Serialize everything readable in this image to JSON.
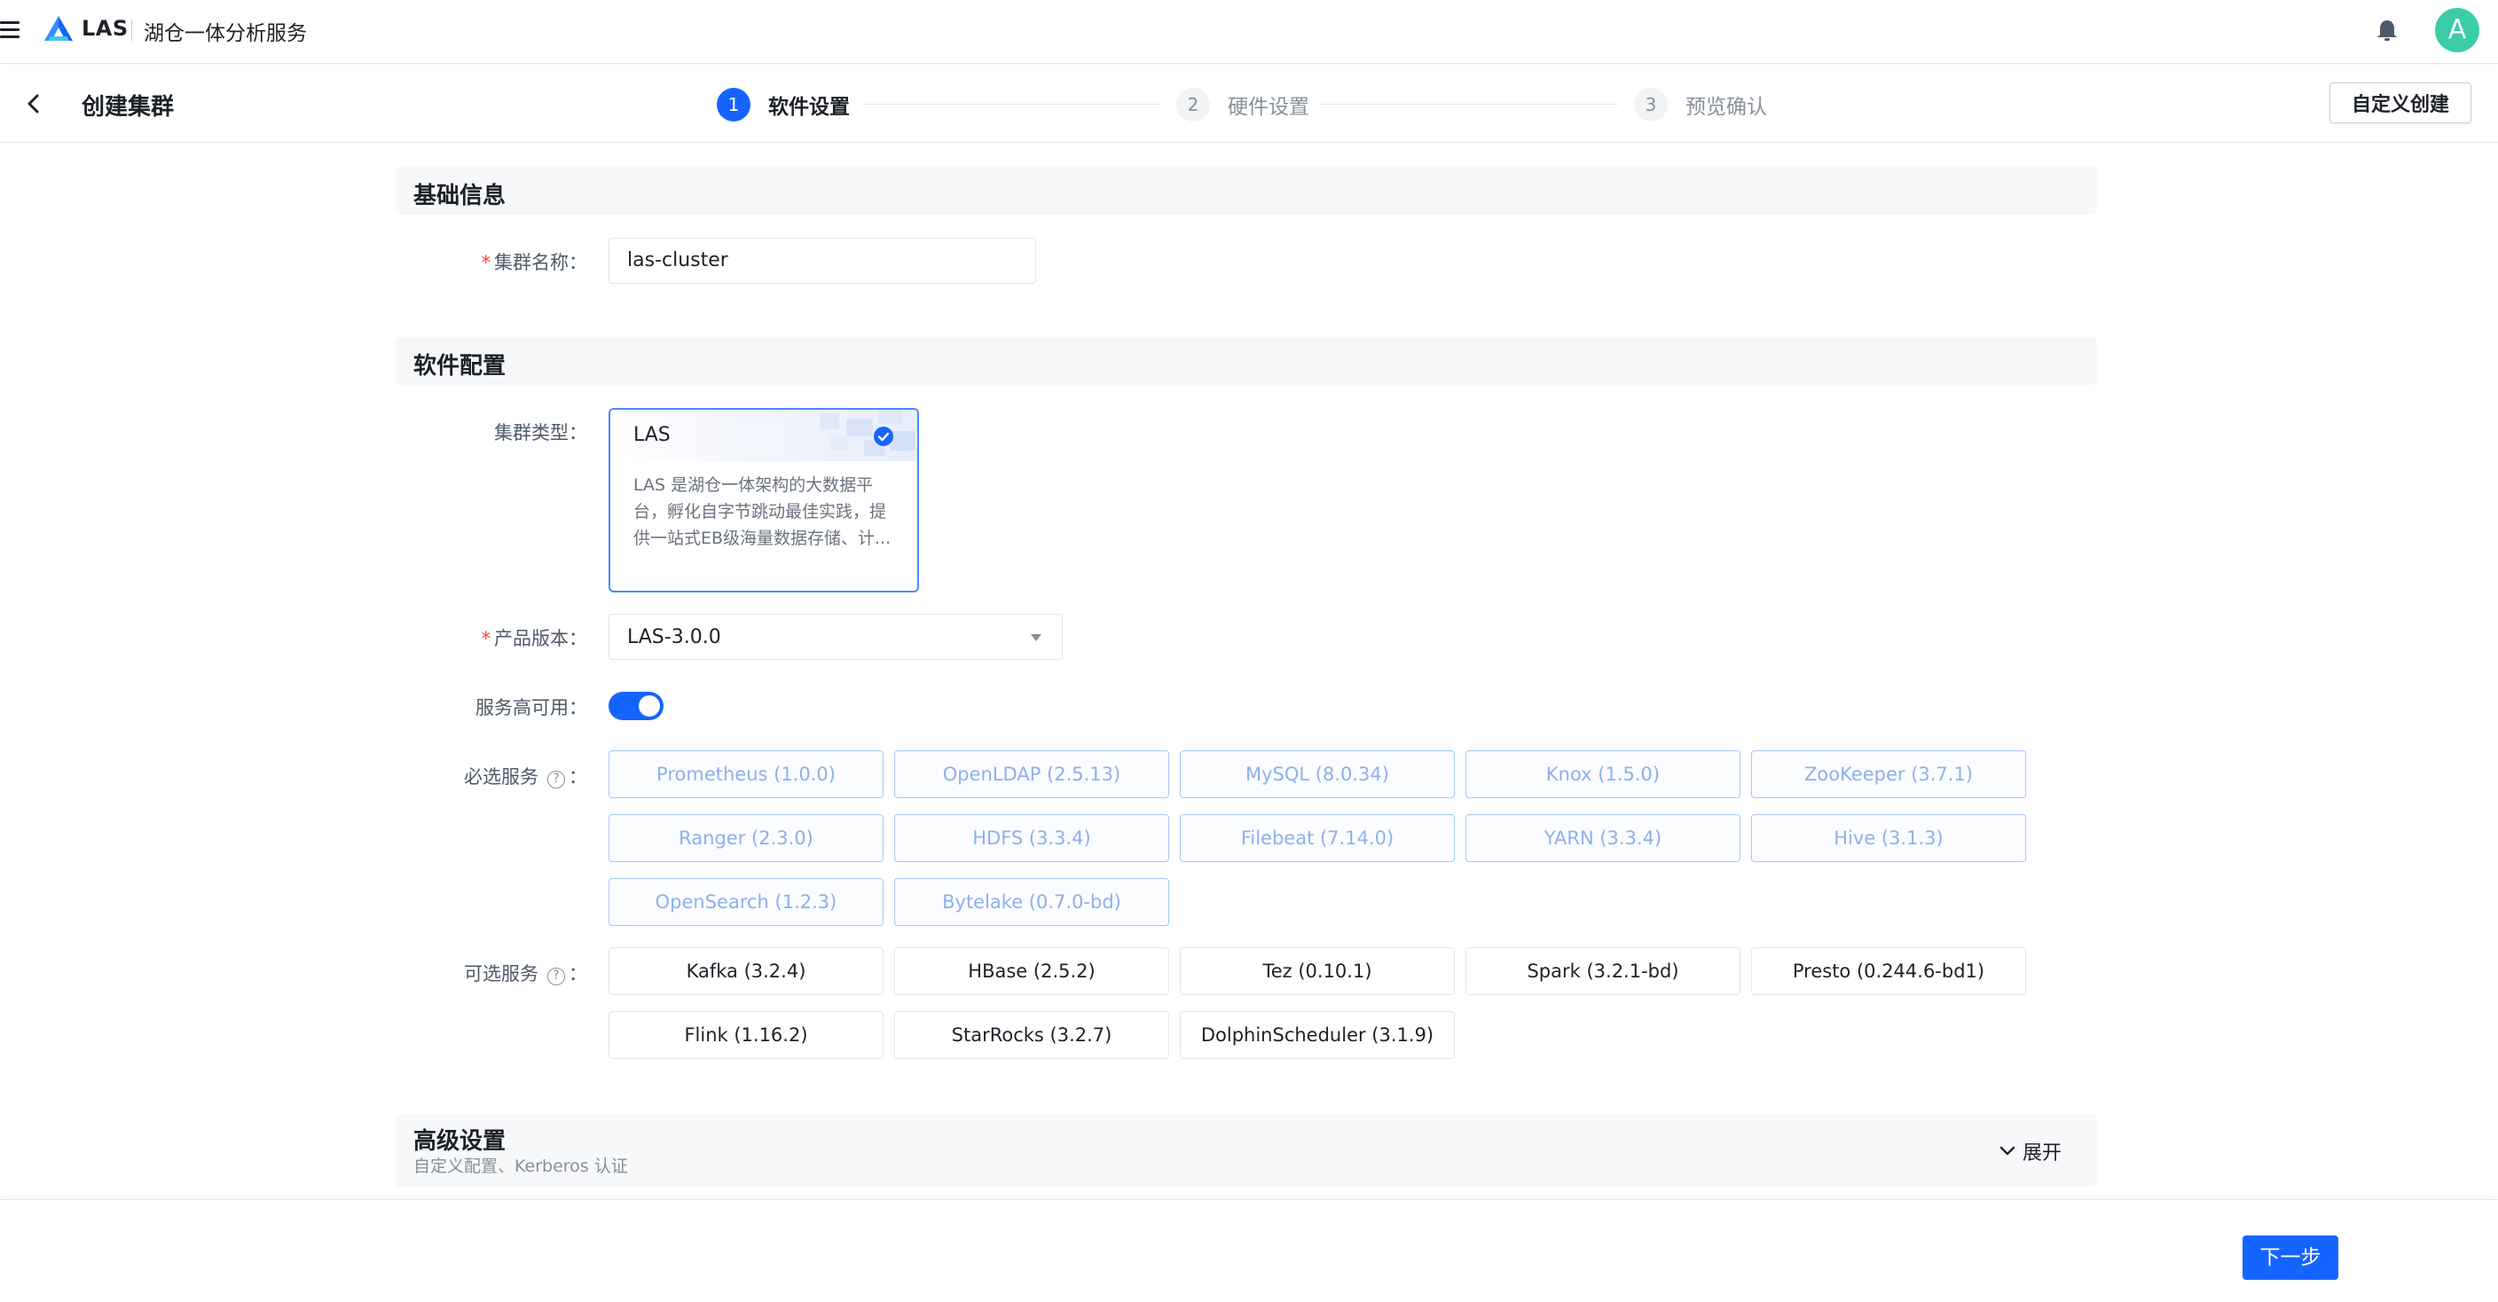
{
  "topbar": {
    "logo_text": "LAS",
    "product_name": "湖仓一体分析服务",
    "avatar_letter": "A",
    "accent": "#1664ff",
    "avatar_color": "#3dcca8"
  },
  "header": {
    "title": "创建集群",
    "custom_create": "自定义创建",
    "steps": [
      {
        "num": "1",
        "label": "软件设置",
        "active": true
      },
      {
        "num": "2",
        "label": "硬件设置",
        "active": false
      },
      {
        "num": "3",
        "label": "预览确认",
        "active": false
      }
    ]
  },
  "basic": {
    "title": "基础信息",
    "cluster_name_label": "集群名称",
    "cluster_name_value": "las-cluster"
  },
  "software": {
    "title": "软件配置",
    "cluster_type_label": "集群类型",
    "cluster_type": {
      "name": "LAS",
      "selected": true,
      "desc_lines": [
        "LAS 是湖仓一体架构的大数据平",
        "台，孵化自字节跳动最佳实践，提",
        "供一站式EB级海量数据存储、计..."
      ]
    },
    "version_label": "产品版本",
    "version_value": "LAS-3.0.0",
    "ha_label": "服务高可用",
    "ha_enabled": true,
    "required_label": "必选服务",
    "required_services": [
      "Prometheus (1.0.0)",
      "OpenLDAP (2.5.13)",
      "MySQL (8.0.34)",
      "Knox (1.5.0)",
      "ZooKeeper (3.7.1)",
      "Ranger (2.3.0)",
      "HDFS (3.3.4)",
      "Filebeat (7.14.0)",
      "YARN (3.3.4)",
      "Hive (3.1.3)",
      "OpenSearch (1.2.3)",
      "Bytelake (0.7.0-bd)"
    ],
    "optional_label": "可选服务",
    "optional_services": [
      "Kafka (3.2.4)",
      "HBase (2.5.2)",
      "Tez (0.10.1)",
      "Spark (3.2.1-bd)",
      "Presto (0.244.6-bd1)",
      "Flink (1.16.2)",
      "StarRocks (3.2.7)",
      "DolphinScheduler (3.1.9)"
    ]
  },
  "advanced": {
    "title": "高级设置",
    "subtitle": "自定义配置、Kerberos 认证",
    "expand_label": "展开"
  },
  "footer": {
    "next_label": "下一步"
  }
}
